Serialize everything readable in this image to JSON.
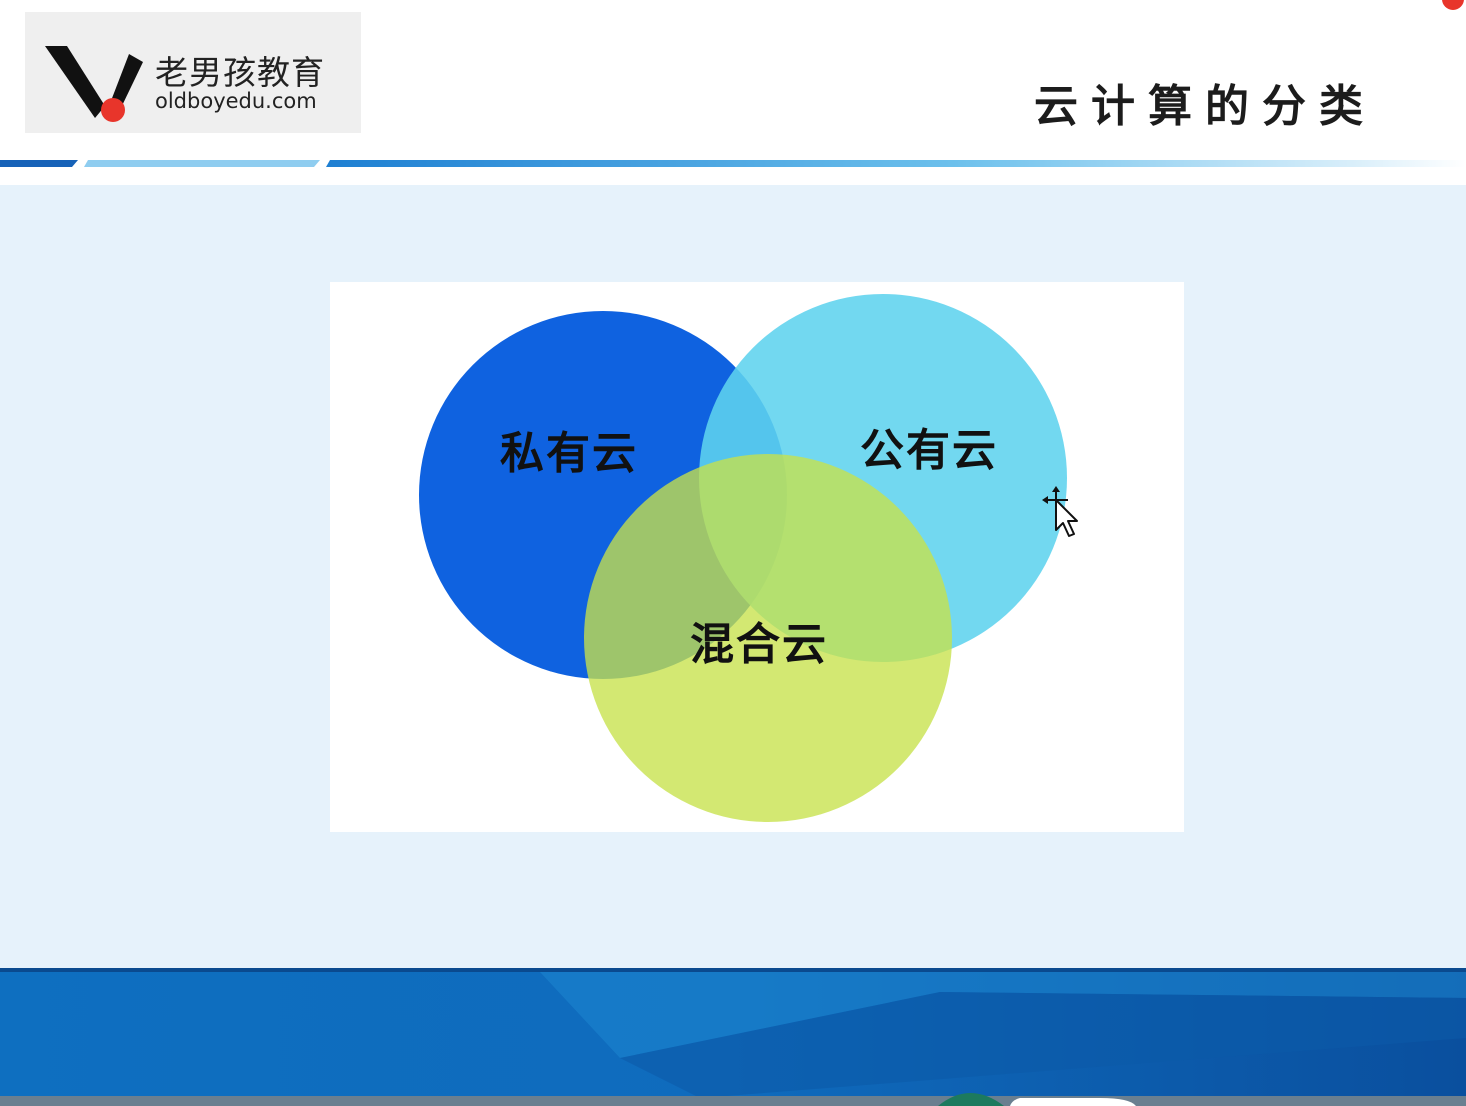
{
  "header": {
    "logo": {
      "name_cn": "老男孩教育",
      "domain": "oldboyedu.com",
      "icon": "oldboy-v-logo-icon"
    },
    "slide_title": "云计算的分类"
  },
  "diagram": {
    "type": "venn",
    "sets": [
      {
        "label": "私有云",
        "color": "#0f62e0"
      },
      {
        "label": "公有云",
        "color": "#5fd3ee"
      },
      {
        "label": "混合云",
        "color": "#c7e24a"
      }
    ]
  },
  "colors": {
    "accent_blue": "#0c5fb5",
    "content_bg": "#e6f2fb",
    "footer_blue": "#0c5fb5",
    "logo_red": "#e8352b"
  },
  "cursor": {
    "icon": "move-cursor-icon"
  }
}
